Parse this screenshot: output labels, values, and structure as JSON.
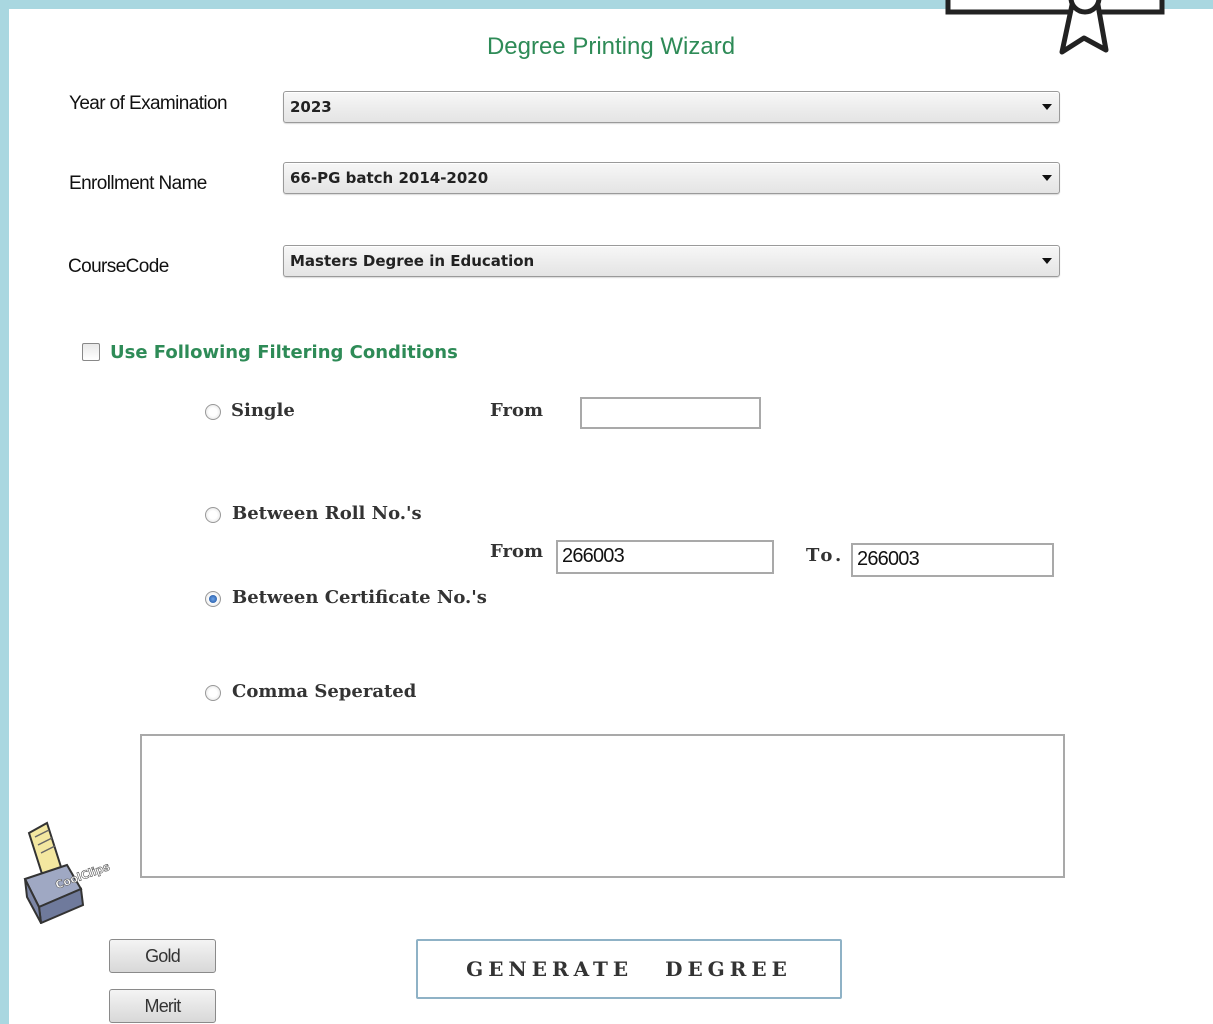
{
  "window": {
    "title": "Degree Printing Wizard"
  },
  "form": {
    "year": {
      "label": "Year of Examination",
      "value": "2023"
    },
    "enrollment": {
      "label": "Enrollment Name",
      "value": "66-PG batch 2014-2020"
    },
    "course": {
      "label": "CourseCode",
      "value": "Masters Degree in Education"
    }
  },
  "filter": {
    "checkbox_label": "Use Following Filtering Conditions",
    "checked": false,
    "options": {
      "single": "Single",
      "roll": "Between Roll No.'s",
      "certificate": "Between Certificate No.'s",
      "comma": "Comma Seperated"
    },
    "selected": "certificate",
    "single_from_label": "From",
    "single_from_value": "",
    "range_from_label": "From",
    "range_from_value": "266003",
    "range_to_label": "To.",
    "range_to_value": "266003",
    "comma_values": ""
  },
  "buttons": {
    "gold": "Gold",
    "merit": "Merit",
    "generate": "GENERATE DEGREE"
  },
  "decor": {
    "clip_text": "CoolClips"
  },
  "icons": {
    "certificate_icon": "ribbon-certificate-icon",
    "clip_icon": "printer-clipart"
  }
}
